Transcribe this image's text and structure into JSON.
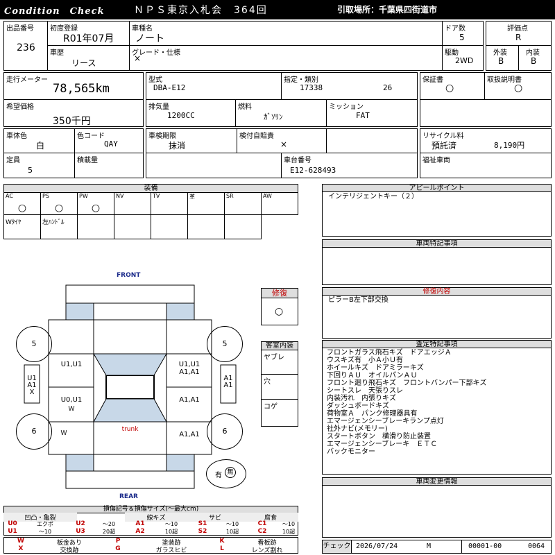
{
  "header": {
    "condition_check": "Condition　Check",
    "auction": "ＮＰＳ東京入札会　364回",
    "pickup": "引取場所：千葉県四街道市"
  },
  "vehicle": {
    "lot_no_label": "出品番号",
    "lot_no": "236",
    "first_reg_label": "初度登録",
    "first_reg": "R01年07月",
    "model_name_label": "車種名",
    "model_name": "ノート",
    "doors_label": "ドア数",
    "doors": "5",
    "eval_label": "評価点",
    "eval": "R",
    "history_label": "車歴",
    "history": "リース",
    "grade_label": "グレード・仕様",
    "grade": "×",
    "drive_label": "駆動",
    "drive": "2WD",
    "exterior_label": "外装",
    "exterior": "B",
    "interior_label": "内装",
    "interior": "B",
    "mileage_label": "走行メーター",
    "mileage": "78,565km",
    "model_code_label": "型式",
    "model_code": "DBA-E12",
    "designation_label": "指定・類別",
    "designation": "17338",
    "category": "26",
    "warranty_label": "保証書",
    "warranty": "○",
    "manual_label": "取扱説明書",
    "manual": "○",
    "desired_price_label": "希望価格",
    "desired_price": "350千円",
    "displacement_label": "排気量",
    "displacement": "1200CC",
    "fuel_label": "燃料",
    "fuel": "ｶﾞｿﾘﾝ",
    "mission_label": "ミッション",
    "mission": "FAT",
    "body_color_label": "車体色",
    "body_color": "白",
    "color_code_label": "色コード",
    "color_code": "QAY",
    "inspection_label": "車検期限",
    "inspection": "抹消",
    "insurance_label": "検付自賠責",
    "insurance": "×",
    "recycle_label": "リサイクル料",
    "recycle_status": "預託済",
    "recycle_fee": "8,190円",
    "capacity_label": "定員",
    "capacity": "5",
    "load_label": "積載量",
    "chassis_label": "車台番号",
    "chassis": "E12-628493",
    "welfare_label": "福祉車両"
  },
  "equipment": {
    "title": "装備",
    "items": [
      {
        "code": "AC",
        "mark": "○"
      },
      {
        "code": "PS",
        "mark": "○"
      },
      {
        "code": "PW",
        "mark": "○"
      },
      {
        "code": "NV",
        "mark": ""
      },
      {
        "code": "TV",
        "mark": ""
      },
      {
        "code": "革",
        "mark": ""
      },
      {
        "code": "SR",
        "mark": ""
      },
      {
        "code": "AW",
        "mark": ""
      }
    ],
    "row2": [
      "Wﾀｲﾔ",
      "左ﾊﾝﾄﾞﾙ",
      "",
      "",
      "",
      "",
      "",
      ""
    ]
  },
  "appeal": {
    "title": "アピールポイント",
    "text": "インテリジェントキー（２）"
  },
  "special": {
    "title": "車両特記事項",
    "text": ""
  },
  "repair": {
    "label": "修復",
    "mark": "○",
    "title": "修復内容",
    "text": "ピラーB左下部交換"
  },
  "cabin": {
    "title": "客室内装",
    "items": [
      "ヤブレ",
      "穴",
      "コゲ"
    ]
  },
  "inspection_notes": {
    "title": "査定特記事項",
    "lines": [
      "フロントガラス飛石キズ　ドアエッジＡ",
      "ウスキズ有　小Ａ小Ｕ有",
      "ホイールキズ　ドアミラーキズ",
      "下回りＡＵ　オイルパンＡＵ",
      "フロント廻り飛石キズ　フロントバンパー下部キズ",
      "シートスレ　天張りスレ",
      "内装汚れ　内張りキズ",
      "ダッシュボードキズ",
      "荷物室Ａ　パンク修理器具有",
      "エマージェンシーブレーキランプ点灯",
      "社外ナビ(メモリー)",
      "スタートボタン　横滑り防止装置",
      "エマージェンシーブレーキ　ＥＴＣ",
      "バックモニター"
    ]
  },
  "change_info": {
    "title": "車両変更情報"
  },
  "diagram": {
    "front": "FRONT",
    "rear": "REAR",
    "trunk": "trunk",
    "tire_fl": "5",
    "tire_fr": "5",
    "tire_rl": "6",
    "tire_rr": "6",
    "left_front_door": "U1,U1",
    "right_front_door_1": "U1,U1",
    "right_front_door_2": "A1,A1",
    "left_rear_door": "U0,U1",
    "right_rear_door": "A1,A1",
    "right_rear_fender": "A1,A1",
    "left_front_fender": "Ｗ",
    "left_pillar_1": "U1",
    "left_pillar_2": "A1",
    "left_pillar_3": "X",
    "right_pillar_1": "A1",
    "right_pillar_2": "A1",
    "spare_label": "有",
    "spare_mark": "無"
  },
  "legend": {
    "title": "損傷記号＆損傷サイズ(〜最大cm)",
    "groups": [
      "凹凸・亀裂",
      "線キズ",
      "サビ",
      "腐食"
    ],
    "row1": [
      "U0",
      "エクボ",
      "U2",
      "〜20",
      "A1",
      "〜10",
      "S1",
      "〜10",
      "C1",
      "〜10"
    ],
    "row2": [
      "U1",
      "〜10",
      "U3",
      "20超",
      "A2",
      "10超",
      "S2",
      "10超",
      "C2",
      "10超"
    ],
    "row3": [
      "W",
      "板金あり",
      "P",
      "塗装跡",
      "K",
      "看板跡"
    ],
    "row4": [
      "X",
      "交換跡",
      "G",
      "ガラスヒビ",
      "L",
      "レンズ割れ"
    ]
  },
  "footer": {
    "check_label": "チェック",
    "date": "2026/07/24",
    "checker": "M",
    "code1": "00001-00",
    "code2": "0064"
  }
}
